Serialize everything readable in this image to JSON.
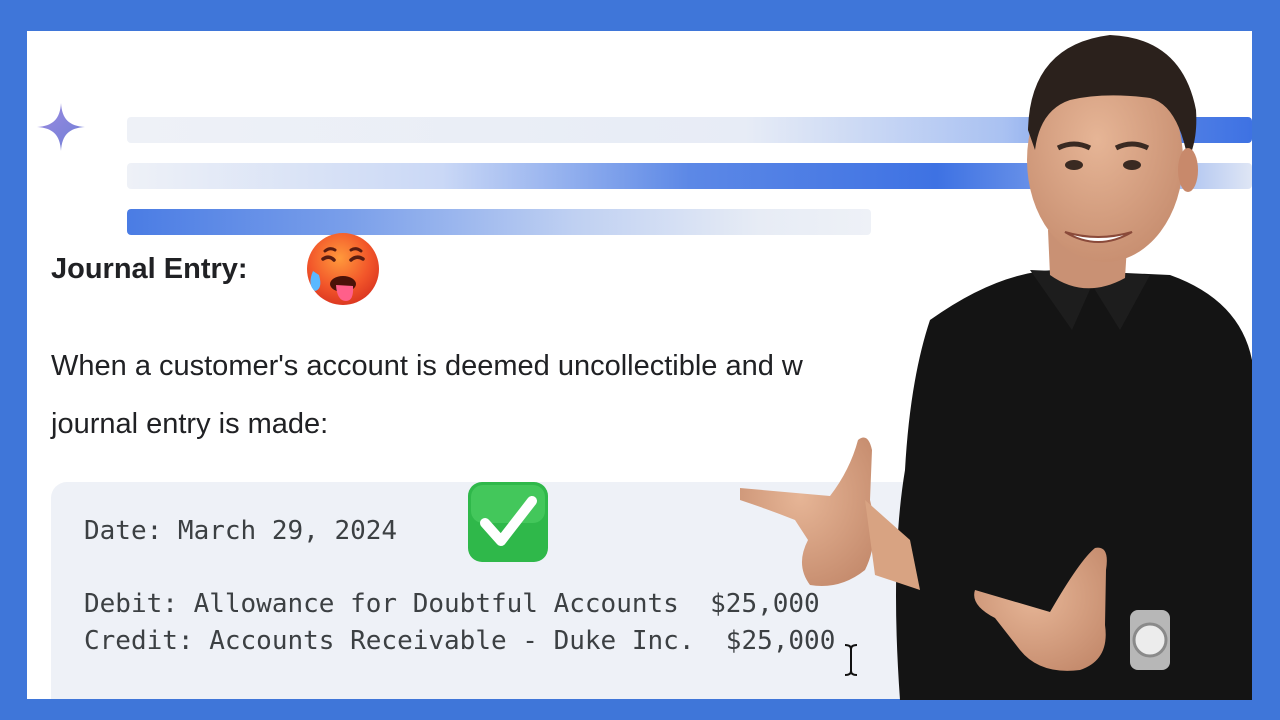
{
  "heading": {
    "text": "Journal Entry:"
  },
  "paragraph": {
    "line1": "When a customer's account is deemed uncollectible and w",
    "line2": "journal entry is made:"
  },
  "code_block": {
    "date_line": "Date: March 29, 2024",
    "debit_line": "Debit: Allowance for Doubtful Accounts  $25,000",
    "credit_line": "Credit: Accounts Receivable - Duke Inc.  $25,000"
  },
  "icons": {
    "sparkle": "sparkle-icon",
    "hot_face": "hot-face-emoji",
    "check": "check-mark-emoji",
    "cursor": "text-cursor-icon"
  },
  "colors": {
    "frame": "#3f76d9",
    "accent_blue": "#3e72e3",
    "sparkle": "#8a7ad6",
    "code_bg": "#eef1f7",
    "check_green": "#34c759"
  }
}
